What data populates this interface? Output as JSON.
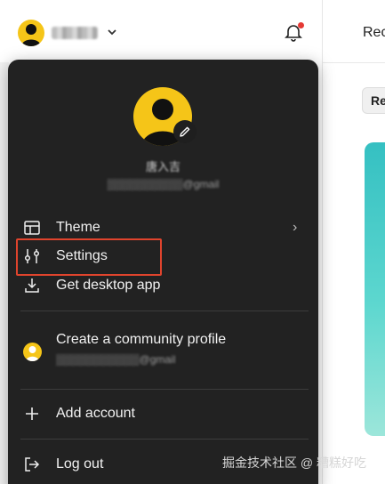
{
  "header": {
    "username": "▓▓▓▓▓",
    "right_pane_title": "Rec",
    "right_pane_chip": "Re"
  },
  "menu": {
    "profile_name": "唐入吉",
    "profile_email": "▒▒▒▒▒▒▒▒▒▒@gmail",
    "items": [
      {
        "label": "Theme",
        "icon": "layout-icon",
        "has_submenu": true
      },
      {
        "label": "Settings",
        "icon": "sliders-icon",
        "highlighted": true
      },
      {
        "label": "Get desktop app",
        "icon": "download-icon"
      },
      {
        "label": "Create a community profile",
        "icon": "avatar"
      },
      {
        "label": "Add account",
        "icon": "plus-icon"
      },
      {
        "label": "Log out",
        "icon": "logout-icon"
      }
    ],
    "community_email": "▒▒▒▒▒▒▒▒▒▒▒@gmail",
    "submenu_arrow": "›"
  },
  "watermark": "掘金技术社区 @ 糟糕好吃",
  "colors": {
    "menu_bg": "#222222",
    "avatar_yellow": "#f5c518",
    "highlight_red": "#e0442d",
    "notification_dot": "#e53935",
    "teal_card": "#35c0c2"
  }
}
